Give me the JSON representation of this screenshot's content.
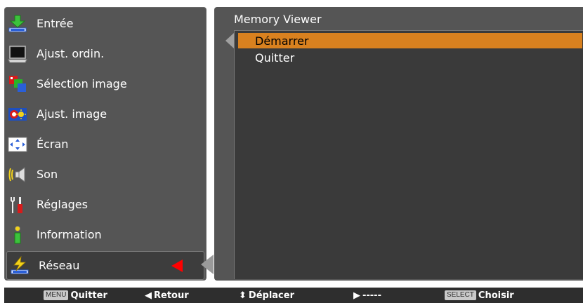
{
  "menu": {
    "items": [
      {
        "label": "Entrée",
        "icon": "input-icon"
      },
      {
        "label": "Ajust. ordin.",
        "icon": "computer-icon"
      },
      {
        "label": "Sélection image",
        "icon": "image-select-icon"
      },
      {
        "label": "Ajust. image",
        "icon": "image-adjust-icon"
      },
      {
        "label": "Écran",
        "icon": "screen-icon"
      },
      {
        "label": "Son",
        "icon": "sound-icon"
      },
      {
        "label": "Réglages",
        "icon": "settings-icon"
      },
      {
        "label": "Information",
        "icon": "information-icon"
      },
      {
        "label": "Réseau",
        "icon": "network-icon"
      }
    ],
    "selected_index": 8
  },
  "submenu": {
    "title": "Memory Viewer",
    "items": [
      {
        "label": "Démarrer",
        "highlighted": true
      },
      {
        "label": "Quitter",
        "highlighted": false
      }
    ]
  },
  "bottom_bar": {
    "menu_key": "MENU",
    "menu_action": "Quitter",
    "back_glyph": "◀",
    "back_action": "Retour",
    "move_glyph": "⬍",
    "move_action": "Déplacer",
    "forward_glyph": "▶",
    "forward_action": "-----",
    "select_key": "SELECT",
    "select_action": "Choisir"
  },
  "colors": {
    "panel": "#555555",
    "highlight": "#d9811f",
    "indicator": "#ff0000"
  }
}
